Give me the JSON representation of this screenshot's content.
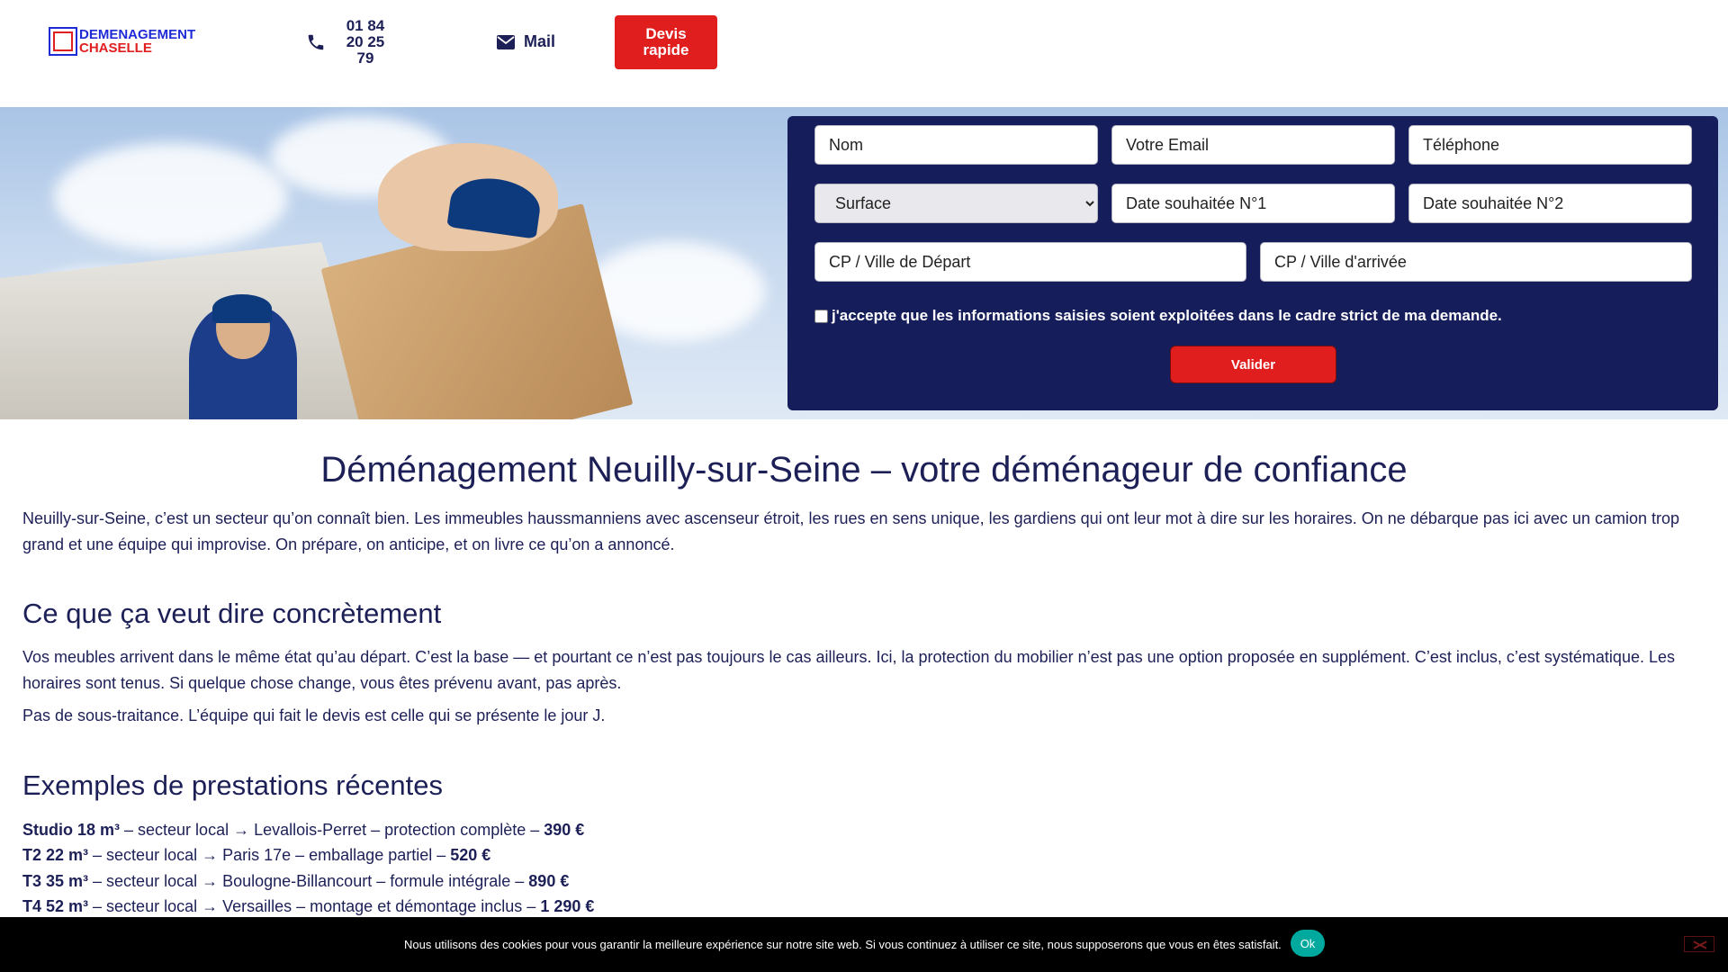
{
  "header": {
    "logo_line1": "DEMENAGEMENT",
    "logo_line2": "CHASELLE",
    "phone_lines": [
      "01 84",
      "20 25",
      "79"
    ],
    "mail_label": "Mail",
    "devis_lines": [
      "Devis",
      "rapide"
    ]
  },
  "form": {
    "nom_placeholder": "Nom",
    "email_placeholder": "Votre Email",
    "telephone_placeholder": "Téléphone",
    "surface_selected": "Surface",
    "date1_placeholder": "Date souhaitée N°1",
    "date2_placeholder": "Date souhaitée N°2",
    "depart_placeholder": "CP / Ville de Départ",
    "arrivee_placeholder": "CP / Ville d'arrivée",
    "consent_text": "j'accepte que les informations saisies soient exploitées dans le cadre strict de ma demande.",
    "submit_label": "Valider"
  },
  "content": {
    "title": "Déménagement Neuilly-sur-Seine – votre déménageur de confiance",
    "intro": "Neuilly-sur-Seine, c’est un secteur qu’on connaît bien. Les immeubles haussmanniens avec ascenseur étroit, les rues en sens unique, les gardiens qui ont leur mot à dire sur les horaires. On ne débarque pas ici avec un camion trop grand et une équipe qui improvise. On prépare, on anticipe, et on livre ce qu’on a annoncé.",
    "section1_title": "Ce que ça veut dire concrètement",
    "section1_p1": "Vos meubles arrivent dans le même état qu’au départ. C’est la base — et pourtant ce n’est pas toujours le cas ailleurs. Ici, la protection du mobilier n’est pas une option proposée en supplément. C’est inclus, c’est systématique. Les horaires sont tenus. Si quelque chose change, vous êtes prévenu avant, pas après.",
    "section1_p2": "Pas de sous-traitance. L’équipe qui fait le devis est celle qui se présente le jour J.",
    "section2_title": "Exemples de prestations récentes",
    "examples": [
      {
        "type": "Studio 18 m³",
        "desc": " – secteur local → Levallois-Perret – protection complète – ",
        "price": "390 €"
      },
      {
        "type": "T2 22 m³",
        "desc": " – secteur local → Paris 17e – emballage partiel – ",
        "price": "520 €"
      },
      {
        "type": "T3 35 m³",
        "desc": " – secteur local → Boulogne-Billancourt – formule intégrale – ",
        "price": "890 €"
      },
      {
        "type": "T4 52 m³",
        "desc": " – secteur local → Versailles – montage et démontage inclus – ",
        "price": "1 290 €"
      }
    ]
  },
  "cookie": {
    "text": "Nous utilisons des cookies pour vous garantir la meilleure expérience sur notre site web. Si vous continuez à utiliser ce site, nous supposerons que vous en êtes satisfait.",
    "ok_label": "Ok"
  },
  "colors": {
    "navy": "#1d2057",
    "form_bg": "#161d5b",
    "accent_red": "#e01e1e",
    "brand_blue": "#1f2bd6",
    "ok_teal": "#00a99d"
  },
  "icons": [
    "phone-icon",
    "envelope-icon",
    "close-icon"
  ]
}
